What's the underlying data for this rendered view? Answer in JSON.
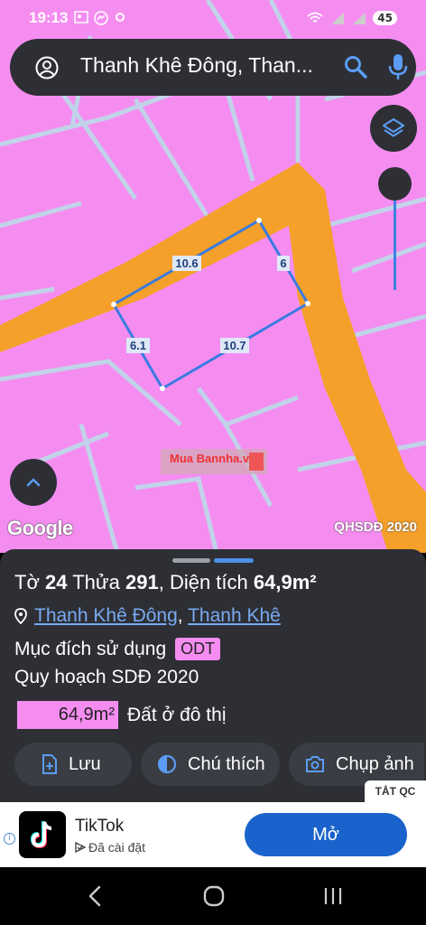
{
  "status_bar": {
    "time": "19:13",
    "left_icons": [
      "gallery-icon",
      "messenger-icon",
      "dots-icon"
    ],
    "right_icons": [
      "wifi-icon",
      "signal-icon",
      "signal-icon"
    ],
    "battery": "45"
  },
  "search": {
    "query": "Thanh Khê Đông, Than..."
  },
  "map": {
    "measurements": [
      "10.6",
      "6",
      "6.1",
      "10.7"
    ],
    "watermark": "Mua Bannha.vn",
    "google_logo": "Google",
    "source_label": "QHSDĐ 2020",
    "colors": {
      "land": "#f58df1",
      "road": "#f5a02a",
      "parcel_outline": "#3a7be0"
    }
  },
  "sheet": {
    "sheet_label": "Tờ",
    "sheet_no": "24",
    "plot_label": "Thửa",
    "plot_no": "291",
    "area_label": "Diện tích",
    "area_value": "64,9m²",
    "ward": "Thanh Khê Đông",
    "district": "Thanh Khê",
    "separator": ",",
    "purpose_label": "Mục đích sử dụng",
    "purpose_code": "ODT",
    "plan_label": "Quy hoạch SDĐ 2020",
    "plan_area": "64,9m²",
    "plan_desc": "Đất ở đô thị",
    "actions": [
      {
        "label": "Lưu",
        "icon": "add-file-icon"
      },
      {
        "label": "Chú thích",
        "icon": "contrast-icon"
      },
      {
        "label": "Chụp ảnh",
        "icon": "camera-icon"
      }
    ]
  },
  "ad": {
    "close_label": "TẮT QC",
    "app_name": "TikTok",
    "status": "Đã cài đặt",
    "cta": "Mở"
  }
}
